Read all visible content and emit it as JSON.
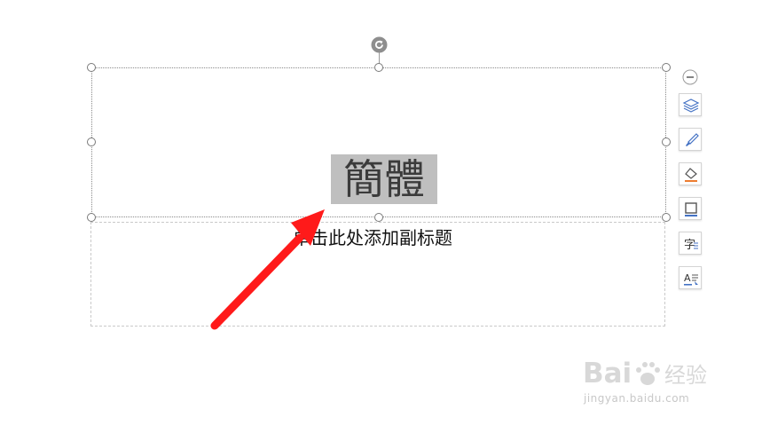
{
  "slide": {
    "title_text": "簡體",
    "subtitle_placeholder": "单击此处添加副标题"
  },
  "toolbar": {
    "buttons": [
      {
        "name": "layers-icon"
      },
      {
        "name": "brush-icon"
      },
      {
        "name": "fill-icon"
      },
      {
        "name": "border-icon"
      },
      {
        "name": "text-wrap-icon"
      },
      {
        "name": "text-effect-icon"
      }
    ]
  },
  "watermark": {
    "logo_text": "Bai 经验",
    "url": "jingyan.baidu.com"
  },
  "colors": {
    "arrow": "#ff1a1a",
    "selection_bg": "#bfbfbf",
    "toolbar_accent": "#4472c4",
    "fill_accent": "#ed7d31"
  }
}
